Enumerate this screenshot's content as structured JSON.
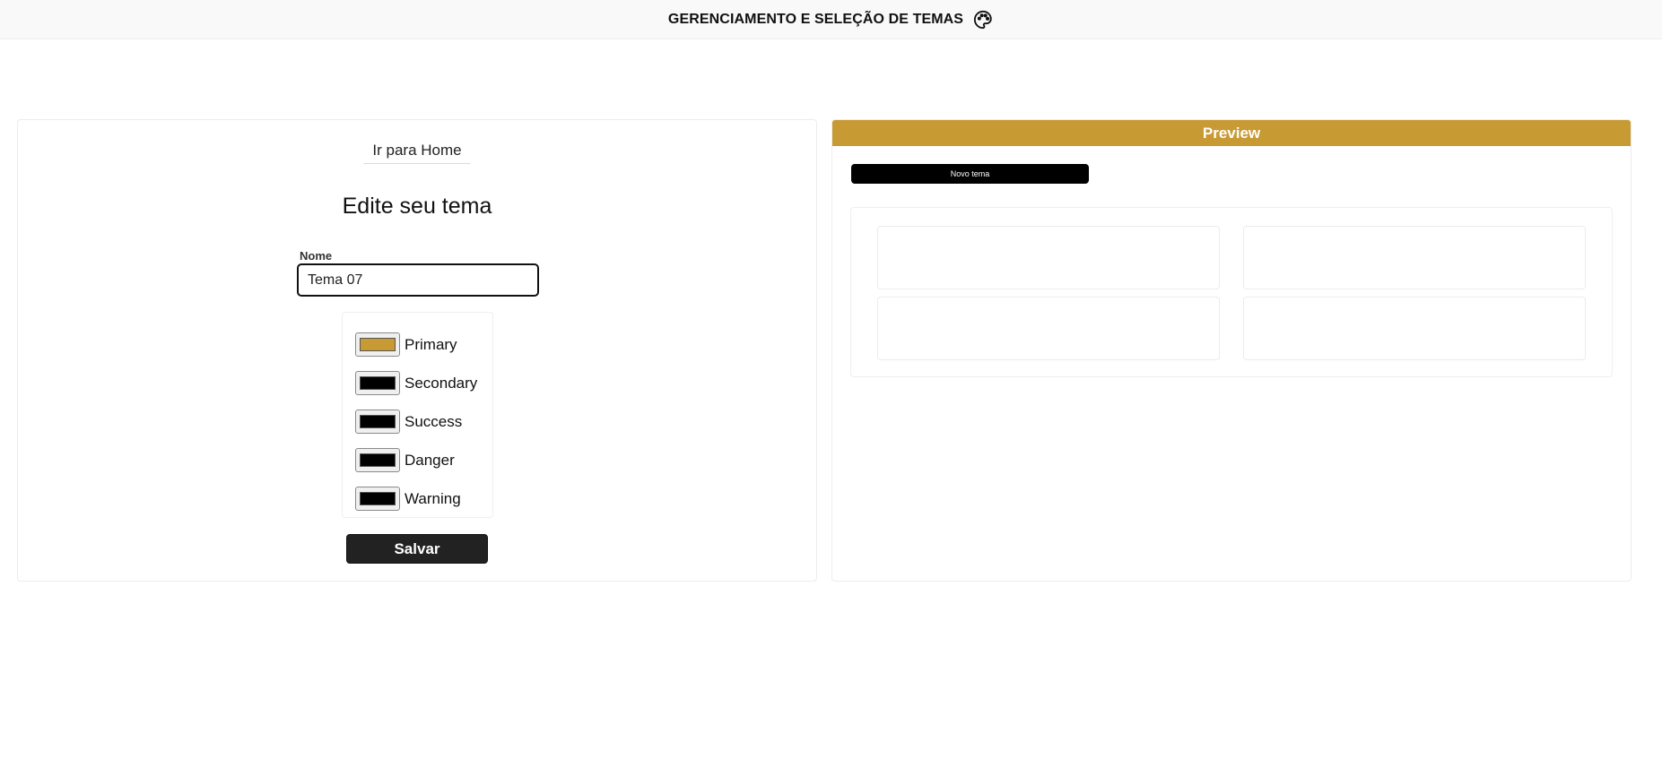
{
  "header": {
    "title": "GERENCIAMENTO E SELEÇÃO DE TEMAS",
    "icon": "palette-icon"
  },
  "editor": {
    "home_link": "Ir para Home",
    "title": "Edite seu tema",
    "name_label": "Nome",
    "name_value": "Tema 07",
    "colors": [
      {
        "label": "Primary",
        "value": "#c89a34"
      },
      {
        "label": "Secondary",
        "value": "#000000"
      },
      {
        "label": "Success",
        "value": "#000000"
      },
      {
        "label": "Danger",
        "value": "#000000"
      },
      {
        "label": "Warning",
        "value": "#000000"
      }
    ],
    "save_label": "Salvar"
  },
  "preview": {
    "title": "Preview",
    "new_theme_label": "Novo tema",
    "accent_color": "#c89a34"
  }
}
